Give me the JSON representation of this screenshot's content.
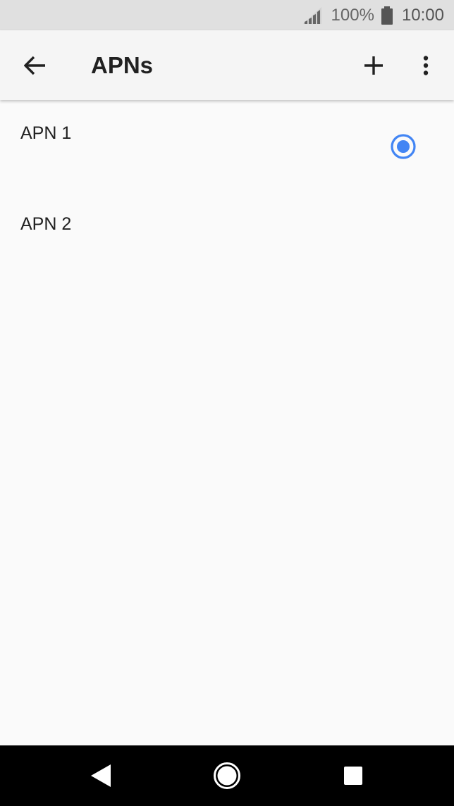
{
  "status_bar": {
    "battery_percent": "100%",
    "time": "10:00",
    "signal_icon": "cell-signal-icon",
    "battery_icon": "battery-full-icon"
  },
  "app_bar": {
    "back_icon": "arrow-back-icon",
    "title": "APNs",
    "add_icon": "plus-icon",
    "more_icon": "more-vert-icon"
  },
  "apn_list": {
    "items": [
      {
        "name": "APN 1",
        "selected": true
      },
      {
        "name": "APN 2",
        "selected": false
      }
    ]
  },
  "nav_bar": {
    "back_icon": "nav-back-triangle-icon",
    "home_icon": "nav-home-circle-icon",
    "recents_icon": "nav-recents-square-icon"
  },
  "colors": {
    "accent": "#4285f4",
    "status_bar_bg": "#e0e0e0",
    "app_bar_bg": "#f5f5f5",
    "background": "#fafafa",
    "nav_bar_bg": "#000000"
  }
}
